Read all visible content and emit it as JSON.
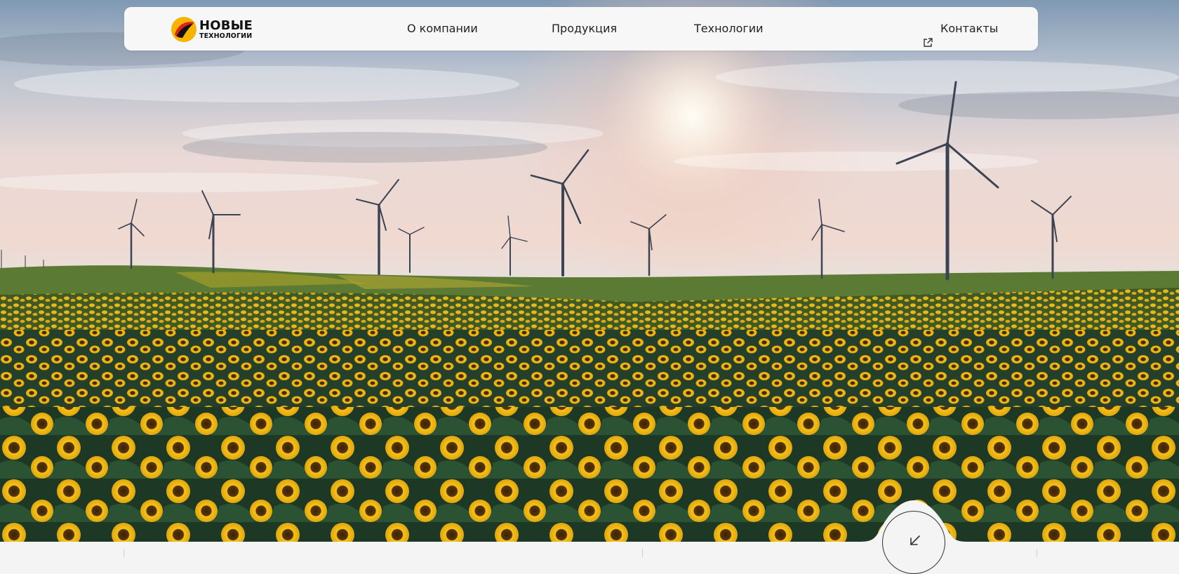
{
  "header": {
    "logo": {
      "line1": "НОВЫЕ",
      "line2": "ТЕХНОЛОГИИ"
    },
    "nav": [
      {
        "label": "О компании"
      },
      {
        "label": "Продукция"
      },
      {
        "label": "Технологии"
      }
    ],
    "contacts": {
      "label": "Контакты",
      "icon": "external-link-icon"
    }
  },
  "hero": {
    "scene": "wind-turbines-over-sunflower-field",
    "scroll_icon": "arrow-down-left-icon"
  },
  "colors": {
    "navbar_bg": "#f7f7f7",
    "logo_red": "#e0211c",
    "logo_yellow": "#f6b400",
    "text": "#222222",
    "page_bg": "#f4f4f4"
  }
}
